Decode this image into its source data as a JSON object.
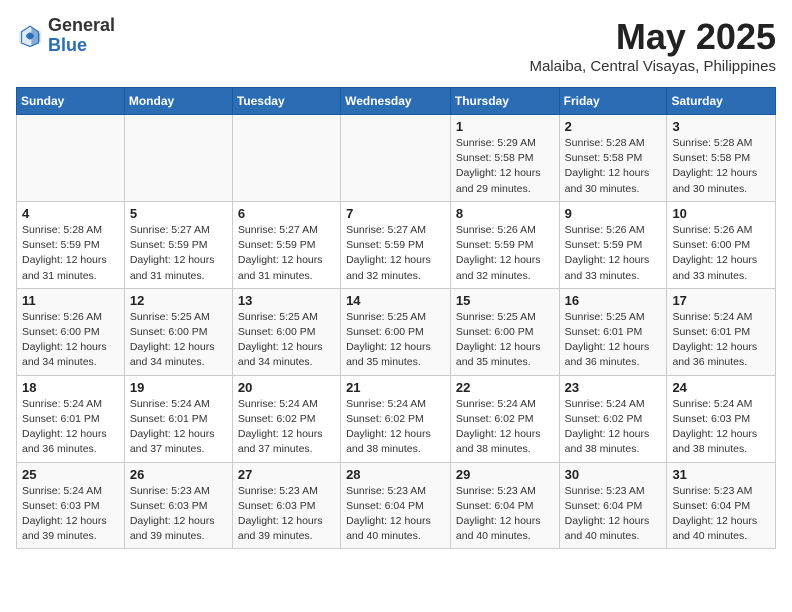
{
  "header": {
    "logo_general": "General",
    "logo_blue": "Blue",
    "month_year": "May 2025",
    "location": "Malaiba, Central Visayas, Philippines"
  },
  "weekdays": [
    "Sunday",
    "Monday",
    "Tuesday",
    "Wednesday",
    "Thursday",
    "Friday",
    "Saturday"
  ],
  "weeks": [
    [
      {
        "day": "",
        "info": ""
      },
      {
        "day": "",
        "info": ""
      },
      {
        "day": "",
        "info": ""
      },
      {
        "day": "",
        "info": ""
      },
      {
        "day": "1",
        "info": "Sunrise: 5:29 AM\nSunset: 5:58 PM\nDaylight: 12 hours\nand 29 minutes."
      },
      {
        "day": "2",
        "info": "Sunrise: 5:28 AM\nSunset: 5:58 PM\nDaylight: 12 hours\nand 30 minutes."
      },
      {
        "day": "3",
        "info": "Sunrise: 5:28 AM\nSunset: 5:58 PM\nDaylight: 12 hours\nand 30 minutes."
      }
    ],
    [
      {
        "day": "4",
        "info": "Sunrise: 5:28 AM\nSunset: 5:59 PM\nDaylight: 12 hours\nand 31 minutes."
      },
      {
        "day": "5",
        "info": "Sunrise: 5:27 AM\nSunset: 5:59 PM\nDaylight: 12 hours\nand 31 minutes."
      },
      {
        "day": "6",
        "info": "Sunrise: 5:27 AM\nSunset: 5:59 PM\nDaylight: 12 hours\nand 31 minutes."
      },
      {
        "day": "7",
        "info": "Sunrise: 5:27 AM\nSunset: 5:59 PM\nDaylight: 12 hours\nand 32 minutes."
      },
      {
        "day": "8",
        "info": "Sunrise: 5:26 AM\nSunset: 5:59 PM\nDaylight: 12 hours\nand 32 minutes."
      },
      {
        "day": "9",
        "info": "Sunrise: 5:26 AM\nSunset: 5:59 PM\nDaylight: 12 hours\nand 33 minutes."
      },
      {
        "day": "10",
        "info": "Sunrise: 5:26 AM\nSunset: 6:00 PM\nDaylight: 12 hours\nand 33 minutes."
      }
    ],
    [
      {
        "day": "11",
        "info": "Sunrise: 5:26 AM\nSunset: 6:00 PM\nDaylight: 12 hours\nand 34 minutes."
      },
      {
        "day": "12",
        "info": "Sunrise: 5:25 AM\nSunset: 6:00 PM\nDaylight: 12 hours\nand 34 minutes."
      },
      {
        "day": "13",
        "info": "Sunrise: 5:25 AM\nSunset: 6:00 PM\nDaylight: 12 hours\nand 34 minutes."
      },
      {
        "day": "14",
        "info": "Sunrise: 5:25 AM\nSunset: 6:00 PM\nDaylight: 12 hours\nand 35 minutes."
      },
      {
        "day": "15",
        "info": "Sunrise: 5:25 AM\nSunset: 6:00 PM\nDaylight: 12 hours\nand 35 minutes."
      },
      {
        "day": "16",
        "info": "Sunrise: 5:25 AM\nSunset: 6:01 PM\nDaylight: 12 hours\nand 36 minutes."
      },
      {
        "day": "17",
        "info": "Sunrise: 5:24 AM\nSunset: 6:01 PM\nDaylight: 12 hours\nand 36 minutes."
      }
    ],
    [
      {
        "day": "18",
        "info": "Sunrise: 5:24 AM\nSunset: 6:01 PM\nDaylight: 12 hours\nand 36 minutes."
      },
      {
        "day": "19",
        "info": "Sunrise: 5:24 AM\nSunset: 6:01 PM\nDaylight: 12 hours\nand 37 minutes."
      },
      {
        "day": "20",
        "info": "Sunrise: 5:24 AM\nSunset: 6:02 PM\nDaylight: 12 hours\nand 37 minutes."
      },
      {
        "day": "21",
        "info": "Sunrise: 5:24 AM\nSunset: 6:02 PM\nDaylight: 12 hours\nand 38 minutes."
      },
      {
        "day": "22",
        "info": "Sunrise: 5:24 AM\nSunset: 6:02 PM\nDaylight: 12 hours\nand 38 minutes."
      },
      {
        "day": "23",
        "info": "Sunrise: 5:24 AM\nSunset: 6:02 PM\nDaylight: 12 hours\nand 38 minutes."
      },
      {
        "day": "24",
        "info": "Sunrise: 5:24 AM\nSunset: 6:03 PM\nDaylight: 12 hours\nand 38 minutes."
      }
    ],
    [
      {
        "day": "25",
        "info": "Sunrise: 5:24 AM\nSunset: 6:03 PM\nDaylight: 12 hours\nand 39 minutes."
      },
      {
        "day": "26",
        "info": "Sunrise: 5:23 AM\nSunset: 6:03 PM\nDaylight: 12 hours\nand 39 minutes."
      },
      {
        "day": "27",
        "info": "Sunrise: 5:23 AM\nSunset: 6:03 PM\nDaylight: 12 hours\nand 39 minutes."
      },
      {
        "day": "28",
        "info": "Sunrise: 5:23 AM\nSunset: 6:04 PM\nDaylight: 12 hours\nand 40 minutes."
      },
      {
        "day": "29",
        "info": "Sunrise: 5:23 AM\nSunset: 6:04 PM\nDaylight: 12 hours\nand 40 minutes."
      },
      {
        "day": "30",
        "info": "Sunrise: 5:23 AM\nSunset: 6:04 PM\nDaylight: 12 hours\nand 40 minutes."
      },
      {
        "day": "31",
        "info": "Sunrise: 5:23 AM\nSunset: 6:04 PM\nDaylight: 12 hours\nand 40 minutes."
      }
    ]
  ]
}
